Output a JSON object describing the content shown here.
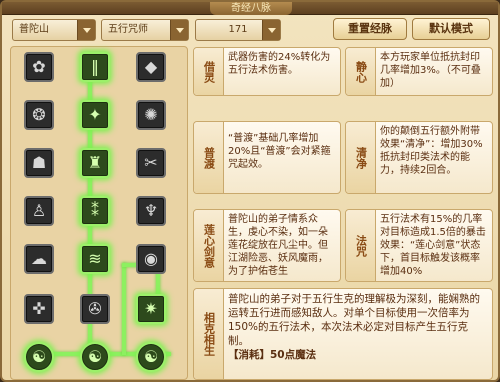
{
  "window": {
    "title": "奇经八脉"
  },
  "filters": {
    "school": "普陀山",
    "element": "五行咒师",
    "points": "171"
  },
  "buttons": {
    "reset": "重置经脉",
    "default": "默认模式"
  },
  "skills": [
    {
      "name": "借灵",
      "desc": "武器伤害的24%转化为五行法术伤害。"
    },
    {
      "name": "静心",
      "desc": "本方玩家单位抵抗封印几率增加3%。（不可叠加）"
    },
    {
      "name": "普渡",
      "desc": "“普渡”基础几率增加20%且“普渡”会对紧箍咒起效。"
    },
    {
      "name": "清净",
      "desc": "你的颠倒五行额外附带效果“清净”：增加30%抵抗封印类法术的能力，持续2回合。"
    },
    {
      "name": "莲心剑意",
      "desc": "普陀山的弟子情系众生，虔心不染，如一朵莲花绽放在凡尘中。但江湖险恶、妖风魔雨，为了护佑苍生"
    },
    {
      "name": "法咒",
      "desc": "五行法术有15%的几率对目标造成1.5倍的暴击效果：“莲心剑意”状态下，首目标触发该概率增加40%"
    },
    {
      "name": "相克相生",
      "desc": "普陀山的弟子对于五行生克的理解极为深刻，能娴熟的运转五行进而感知敌人。对单个目标使用一次倍率为150%的五行法术，本次法术必定对目标产生五行克制。",
      "cost": "【消耗】50点魔法"
    }
  ],
  "tree": {
    "icons": [
      "lotus-icon",
      "bamboo-icon",
      "scroll-icon",
      "beads-icon",
      "sword-icon",
      "flame-icon",
      "mask-icon",
      "vase-icon",
      "blade-icon",
      "figure-icon",
      "reed-icon",
      "lamp-icon",
      "cloud-icon",
      "water-icon",
      "orb-icon",
      "dragon-icon",
      "wheel-icon",
      "star-icon",
      "yinyang-icon",
      "yinyang-icon",
      "yinyang-icon"
    ],
    "active": [
      1,
      4,
      7,
      10,
      13,
      17,
      18,
      19,
      20
    ]
  },
  "colors": {
    "active_glow": "#7ef050",
    "label_text": "#8a4b14",
    "body_text": "#5a2e10"
  }
}
